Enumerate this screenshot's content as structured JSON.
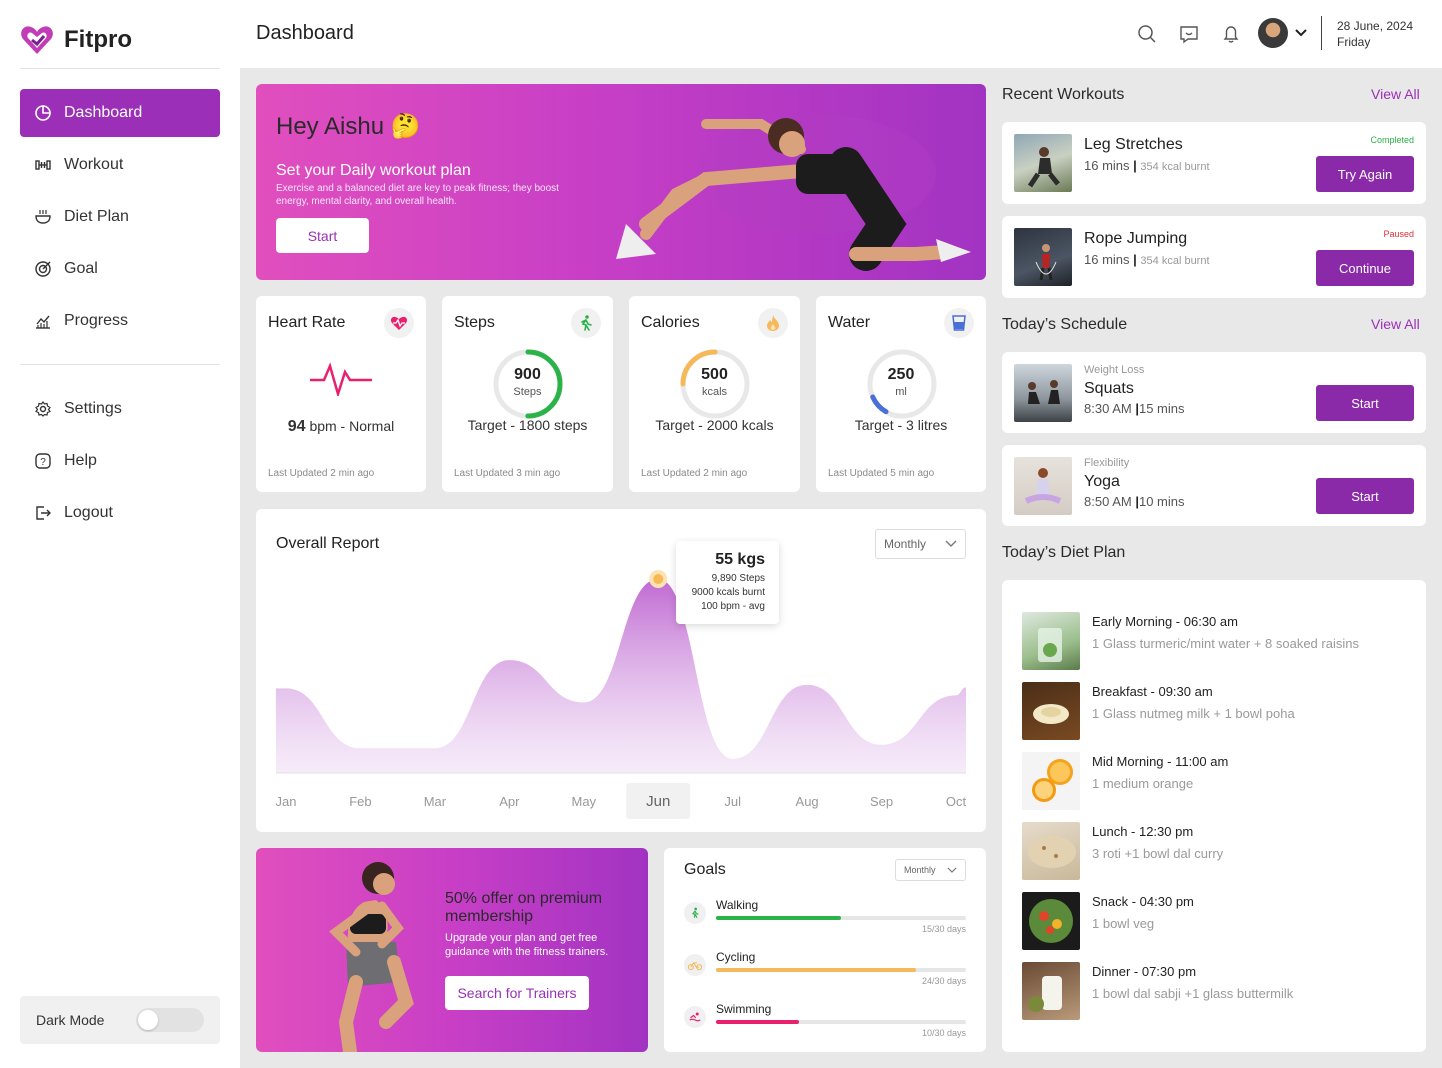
{
  "app": {
    "name": "Fitpro"
  },
  "sidebar": {
    "items": [
      {
        "label": "Dashboard",
        "icon": "dashboard-icon",
        "active": true
      },
      {
        "label": "Workout",
        "icon": "dumbbell-icon"
      },
      {
        "label": "Diet Plan",
        "icon": "bowl-icon"
      },
      {
        "label": "Goal",
        "icon": "target-icon"
      },
      {
        "label": "Progress",
        "icon": "chart-icon"
      }
    ],
    "bottom_items": [
      {
        "label": "Settings",
        "icon": "gear-icon"
      },
      {
        "label": "Help",
        "icon": "help-icon"
      },
      {
        "label": "Logout",
        "icon": "logout-icon"
      }
    ],
    "dark_mode_label": "Dark Mode"
  },
  "header": {
    "title": "Dashboard",
    "date": "28 June, 2024",
    "day": "Friday"
  },
  "hero": {
    "greeting": "Hey Aishu",
    "emoji": "🤔",
    "subtitle": "Set your Daily workout plan",
    "text": "Exercise and a balanced diet are key to peak fitness; they boost energy, mental clarity, and overall health.",
    "button": "Start"
  },
  "stats": {
    "heart": {
      "title": "Heart Rate",
      "value": "94",
      "unit": "bpm - Normal",
      "updated": "Last Updated 2 min ago"
    },
    "steps": {
      "title": "Steps",
      "value": "900",
      "unit": "Steps",
      "target": "Target - 1800 steps",
      "updated": "Last Updated 3 min ago",
      "progress": 0.5
    },
    "calories": {
      "title": "Calories",
      "value": "500",
      "unit": "kcals",
      "target": "Target - 2000 kcals",
      "updated": "Last Updated 2 min ago",
      "progress": 0.25
    },
    "water": {
      "title": "Water",
      "value": "250",
      "unit": "ml",
      "target": "Target - 3 litres",
      "updated": "Last Updated 5 min ago",
      "progress": 0.1
    }
  },
  "report": {
    "title": "Overall Report",
    "period": "Monthly",
    "tooltip": {
      "value": "55 kgs",
      "line1": "9,890 Steps",
      "line2": "9000 kcals burnt",
      "line3": "100 bpm - avg"
    },
    "selected_month": "Jun"
  },
  "chart_data": {
    "type": "area",
    "x": [
      "Jan",
      "Feb",
      "Mar",
      "Apr",
      "May",
      "Jun",
      "Jul",
      "Aug",
      "Sep",
      "Oct"
    ],
    "values": [
      24,
      7,
      7,
      32,
      20,
      55,
      4,
      25,
      8,
      22
    ],
    "title": "Overall Report",
    "highlight": {
      "x": "Jun",
      "value": 55
    },
    "grid": false
  },
  "promo": {
    "title": "50% offer on premium membership",
    "text": "Upgrade your plan and get free guidance with the fitness trainers.",
    "button": "Search for Trainers"
  },
  "goals": {
    "title": "Goals",
    "period": "Monthly",
    "items": [
      {
        "label": "Walking",
        "days": "15/30 days",
        "progress": 0.5,
        "color": "#2bb34a",
        "icon": "walking-icon"
      },
      {
        "label": "Cycling",
        "days": "24/30 days",
        "progress": 0.8,
        "color": "#f5b95a",
        "icon": "cycling-icon"
      },
      {
        "label": "Swimming",
        "days": "10/30 days",
        "progress": 0.33,
        "color": "#e8206e",
        "icon": "swimming-icon"
      }
    ]
  },
  "recent_workouts": {
    "title": "Recent Workouts",
    "view_all": "View All",
    "items": [
      {
        "name": "Leg Stretches",
        "mins": "16 mins",
        "kcal": "354 kcal burnt",
        "status": "Completed",
        "status_color": "#2bb34a",
        "button": "Try Again"
      },
      {
        "name": "Rope Jumping",
        "mins": "16 mins",
        "kcal": "354 kcal burnt",
        "status": "Paused",
        "status_color": "#e0303a",
        "button": "Continue"
      }
    ]
  },
  "schedule": {
    "title": "Today’s Schedule",
    "view_all": "View All",
    "items": [
      {
        "category": "Weight Loss",
        "name": "Squats",
        "time": "8:30 AM",
        "duration": "15 mins",
        "button": "Start"
      },
      {
        "category": "Flexibility",
        "name": "Yoga",
        "time": "8:50 AM",
        "duration": "10 mins",
        "button": "Start"
      }
    ]
  },
  "diet": {
    "title": "Today’s Diet Plan",
    "items": [
      {
        "meal": "Early Morning - 06:30 am",
        "desc": "1 Glass turmeric/mint water + 8 soaked raisins"
      },
      {
        "meal": "Breakfast - 09:30 am",
        "desc": "1 Glass nutmeg milk + 1 bowl poha"
      },
      {
        "meal": "Mid Morning - 11:00 am",
        "desc": "1 medium orange"
      },
      {
        "meal": "Lunch - 12:30 pm",
        "desc": "3 roti +1 bowl dal curry"
      },
      {
        "meal": "Snack - 04:30 pm",
        "desc": "1 bowl veg"
      },
      {
        "meal": "Dinner - 07:30 pm",
        "desc": "1 bowl dal sabji +1 glass buttermilk"
      }
    ]
  },
  "colors": {
    "brand": "#9b2fb7",
    "background": "#e8e8e8"
  }
}
